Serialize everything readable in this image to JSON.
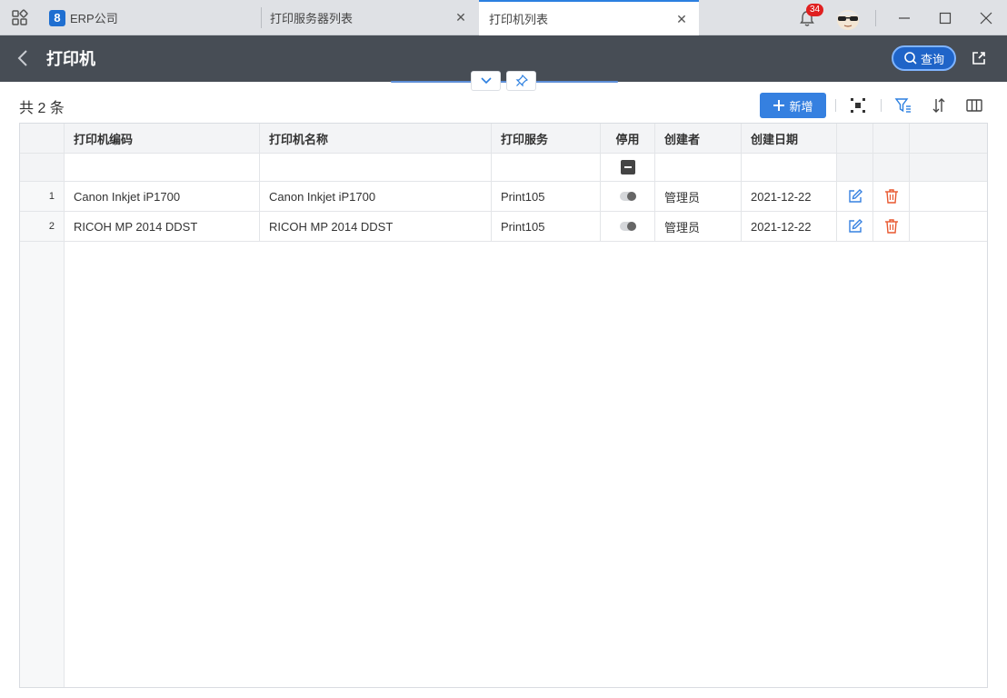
{
  "tabs": [
    {
      "label": "ERP公司",
      "logo": "8"
    },
    {
      "label": "打印服务器列表"
    },
    {
      "label": "打印机列表"
    }
  ],
  "notifications": {
    "count": "34"
  },
  "header": {
    "title": "打印机",
    "query_label": "查询"
  },
  "toolbar": {
    "count_text": "共 2 条",
    "add_label": "新增"
  },
  "table": {
    "columns": [
      "打印机编码",
      "打印机名称",
      "打印服务",
      "停用",
      "创建者",
      "创建日期"
    ],
    "rows": [
      {
        "num": "1",
        "code": "Canon Inkjet iP1700",
        "name": "Canon Inkjet iP1700",
        "service": "Print105",
        "disabled": false,
        "creator": "管理员",
        "date": "2021-12-22"
      },
      {
        "num": "2",
        "code": "RICOH MP 2014 DDST",
        "name": "RICOH MP 2014 DDST",
        "service": "Print105",
        "disabled": false,
        "creator": "管理员",
        "date": "2021-12-22"
      }
    ]
  },
  "colors": {
    "accent": "#3580e0",
    "header_bg": "#474d55",
    "delete": "#e8572e"
  },
  "icons": [
    "apps-grid-icon",
    "close-icon",
    "bell-icon",
    "avatar-icon",
    "minimize-icon",
    "maximize-icon",
    "back-icon",
    "search-icon",
    "export-icon",
    "chevron-down-icon",
    "pin-icon",
    "plus-icon",
    "fullscreen-icon",
    "filter-icon",
    "sort-icon",
    "columns-icon",
    "edit-icon",
    "delete-icon"
  ]
}
